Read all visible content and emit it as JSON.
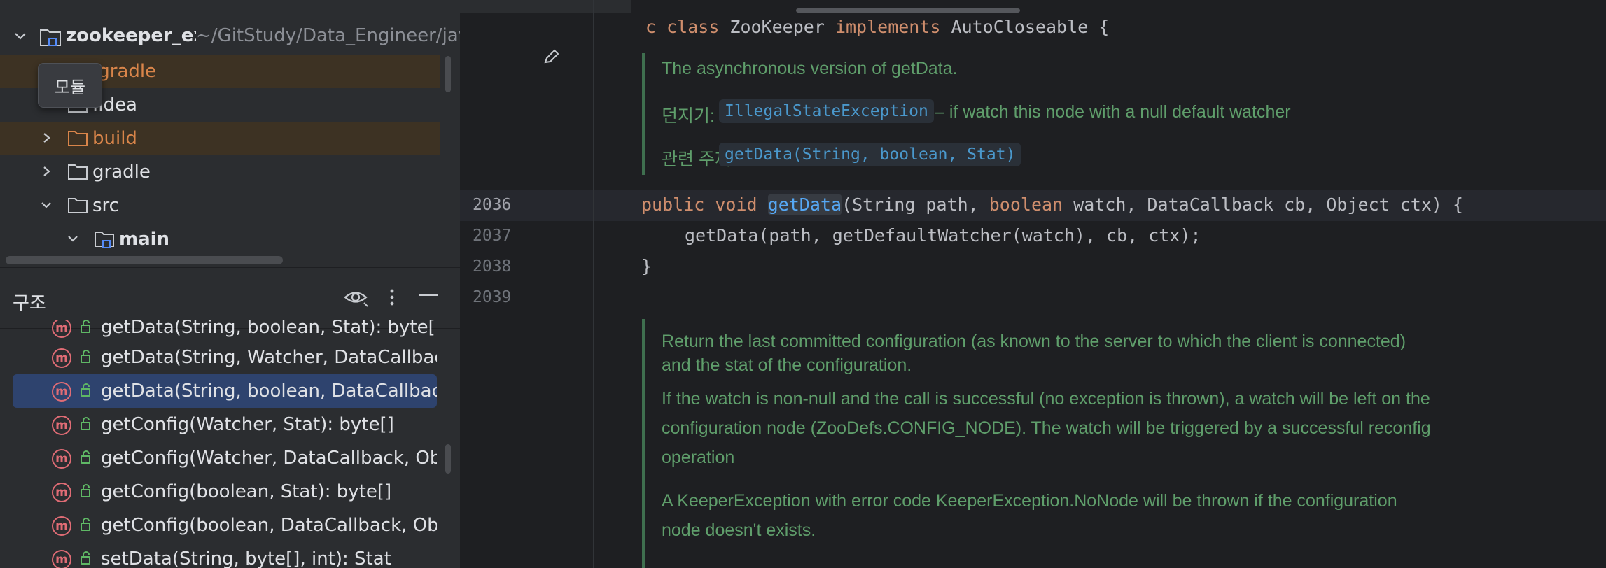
{
  "project_tree": {
    "root": {
      "name": "zookeeper_ex",
      "path": "~/GitStudy/Data_Engineer/javaProject/zookeeper_ex"
    },
    "items": [
      {
        "label": ".gradle"
      },
      {
        "label": ".idea"
      },
      {
        "label": "build"
      },
      {
        "label": "gradle"
      },
      {
        "label": "src"
      },
      {
        "label": "main"
      }
    ],
    "tooltip": "모듈"
  },
  "structure": {
    "title": "구조",
    "items": [
      {
        "signature": "getData(String, boolean, Stat): byte[]"
      },
      {
        "signature": "getData(String, Watcher, DataCallback, Object): void"
      },
      {
        "signature": "getData(String, boolean, DataCallback, Object): void"
      },
      {
        "signature": "getConfig(Watcher, Stat): byte[]"
      },
      {
        "signature": "getConfig(Watcher, DataCallback, Object): void"
      },
      {
        "signature": "getConfig(boolean, Stat): byte[]"
      },
      {
        "signature": "getConfig(boolean, DataCallback, Object): void"
      },
      {
        "signature": "setData(String, byte[], int): Stat"
      }
    ],
    "method_icon_letter": "m"
  },
  "editor": {
    "class_decl": {
      "prefix": "c ",
      "kw_class": "class",
      "name": " ZooKeeper ",
      "kw_implements": "implements",
      "rest": " AutoCloseable {"
    },
    "doc1": {
      "summary": "The asynchronous version of getData.",
      "throws_label": "던지기:",
      "throws_type": "IllegalStateException",
      "throws_desc": "– if watch this node with a null default watcher",
      "see_label": "관련 주제:",
      "see_ref": "getData(String, boolean, Stat)"
    },
    "lines": {
      "n2036": "2036",
      "n2037": "2037",
      "n2038": "2038",
      "n2039": "2039"
    },
    "code_2036": {
      "kw_public": "public",
      "kw_void": "void",
      "method": "getData",
      "p1": "(String path, ",
      "kw_boolean": "boolean",
      "p2": " watch, DataCallback cb, Object ctx) {"
    },
    "code_2037": "getData(path, getDefaultWatcher(watch), cb, ctx);",
    "code_2038": "}",
    "doc2": {
      "line1": "Return the last committed configuration (as known to the server to which the client is connected)",
      "line2": "and the stat of the configuration.",
      "line3": "If the watch is non-null and the call is successful (no exception is thrown), a watch will be left on the",
      "line4": "configuration node (ZooDefs.CONFIG_NODE). The watch will be triggered by a successful reconfig",
      "line5": "operation",
      "line6": "A KeeperException with error code KeeperException.NoNode will be thrown if the configuration",
      "line7": "node doesn't exists."
    }
  },
  "colors": {
    "keyword": "#cf8e6d",
    "method_call": "#56a8f5",
    "doc_text": "#5f9e6b",
    "excluded_folder": "#d9854a",
    "selection": "#2e436e"
  }
}
